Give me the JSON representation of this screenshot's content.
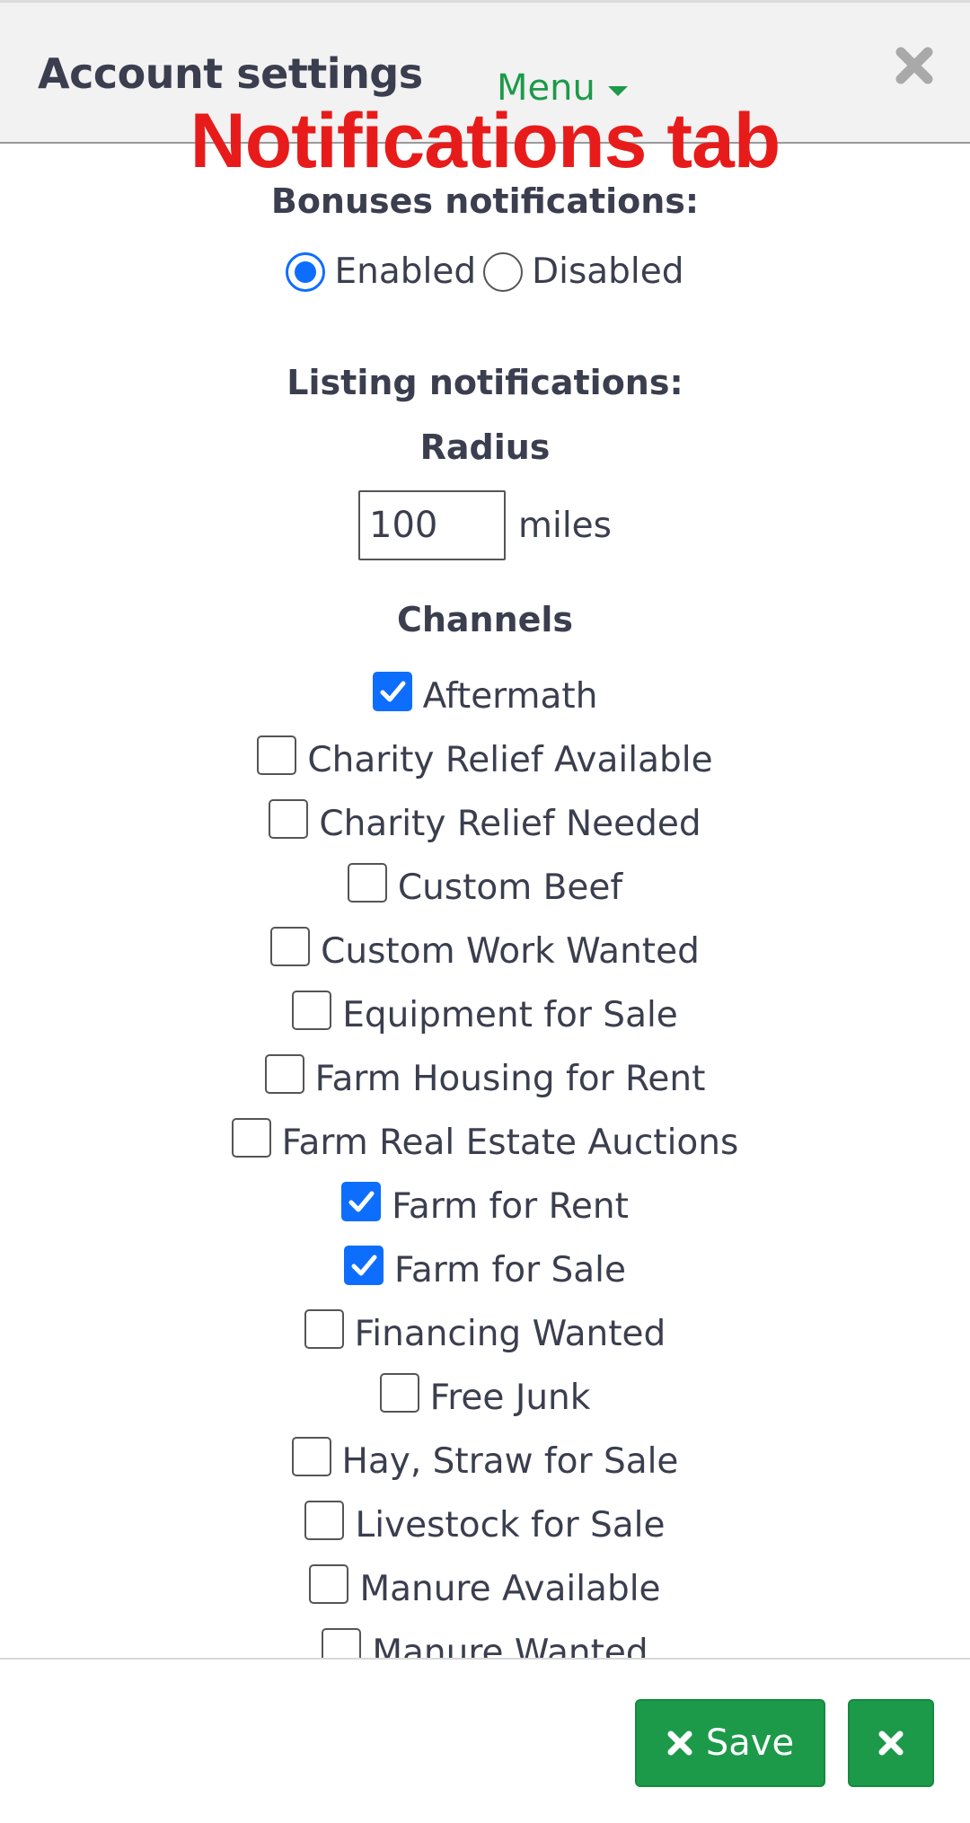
{
  "header": {
    "title": "Account settings",
    "menu_label": "Menu",
    "overlay_label": "Notifications tab"
  },
  "bonuses": {
    "heading": "Bonuses notifications:",
    "options": [
      {
        "label": "Enabled",
        "selected": true
      },
      {
        "label": "Disabled",
        "selected": false
      }
    ]
  },
  "listing": {
    "heading": "Listing notifications:",
    "radius_label": "Radius",
    "radius_value": "100",
    "radius_unit": "miles",
    "channels_label": "Channels",
    "channels": [
      {
        "label": "Aftermath",
        "checked": true
      },
      {
        "label": "Charity Relief Available",
        "checked": false
      },
      {
        "label": "Charity Relief Needed",
        "checked": false
      },
      {
        "label": "Custom Beef",
        "checked": false
      },
      {
        "label": "Custom Work Wanted",
        "checked": false
      },
      {
        "label": "Equipment for Sale",
        "checked": false
      },
      {
        "label": "Farm Housing for Rent",
        "checked": false
      },
      {
        "label": "Farm Real Estate Auctions",
        "checked": false
      },
      {
        "label": "Farm for Rent",
        "checked": true
      },
      {
        "label": "Farm for Sale",
        "checked": true
      },
      {
        "label": "Financing Wanted",
        "checked": false
      },
      {
        "label": "Free Junk",
        "checked": false
      },
      {
        "label": "Hay, Straw for Sale",
        "checked": false
      },
      {
        "label": "Livestock for Sale",
        "checked": false
      },
      {
        "label": "Manure Available",
        "checked": false
      },
      {
        "label": "Manure Wanted",
        "checked": false
      }
    ]
  },
  "footer": {
    "save_label": "Save"
  },
  "colors": {
    "primary_green": "#1c9a4a",
    "checkbox_blue": "#0d6efd",
    "overlay_red": "#e81b1b"
  },
  "icons": {
    "close": "close-icon",
    "caret": "caret-down-icon",
    "check": "checkmark-icon",
    "save": "times-icon"
  }
}
